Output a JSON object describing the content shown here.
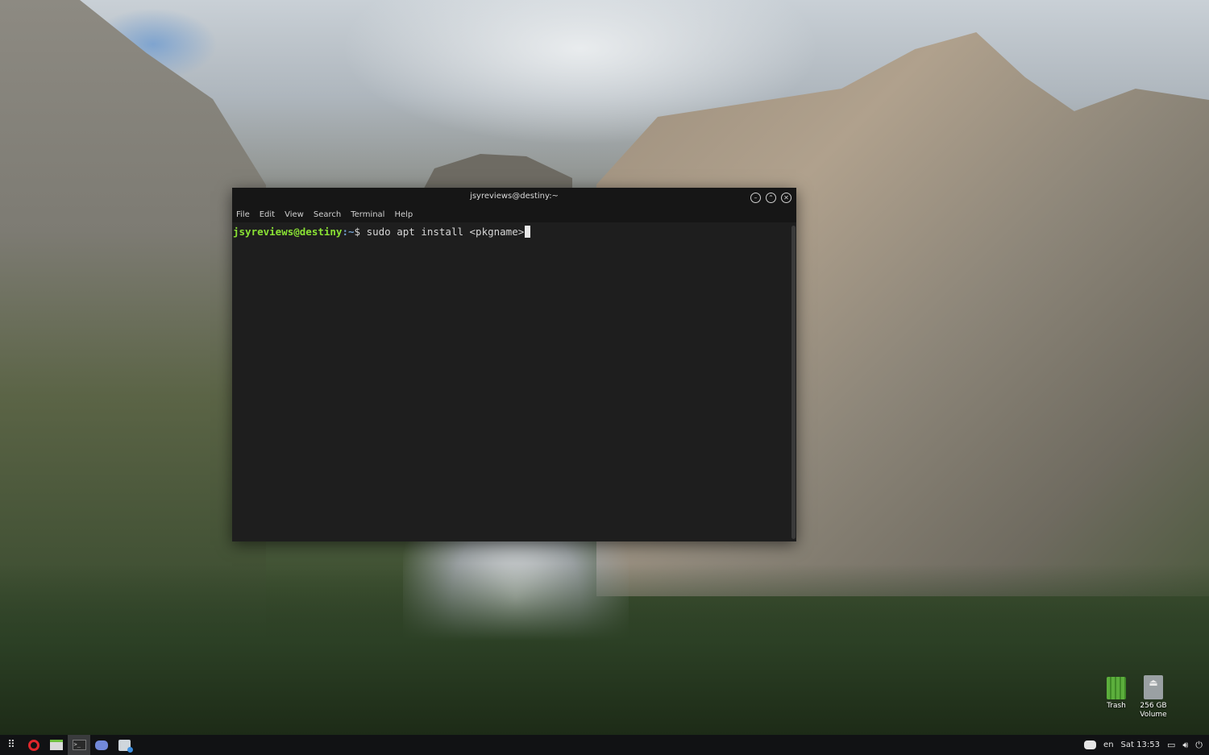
{
  "terminal": {
    "title": "jsyreviews@destiny:~",
    "menu": [
      "File",
      "Edit",
      "View",
      "Search",
      "Terminal",
      "Help"
    ],
    "prompt_user_host": "jsyreviews@destiny",
    "prompt_path": ":~",
    "prompt_symbol": "$",
    "command": " sudo apt install <pkgname>"
  },
  "desktop_icons": {
    "trash": {
      "label": "Trash",
      "icon": "trash-icon"
    },
    "volume": {
      "label": "256 GB Volume",
      "icon": "drive-icon"
    }
  },
  "taskbar": {
    "apps": [
      {
        "icon": "app-grid-icon"
      },
      {
        "icon": "opera-icon"
      },
      {
        "icon": "files-icon"
      },
      {
        "icon": "terminal-icon",
        "active": true
      },
      {
        "icon": "discord-icon"
      },
      {
        "icon": "software-store-icon"
      }
    ],
    "tray": {
      "language": "en",
      "clock": "Sat 13:53"
    }
  },
  "colors": {
    "prompt_green": "#8ae234",
    "prompt_blue": "#729fcf",
    "terminal_bg": "#1e1e1e",
    "taskbar_bg": "#111214"
  }
}
